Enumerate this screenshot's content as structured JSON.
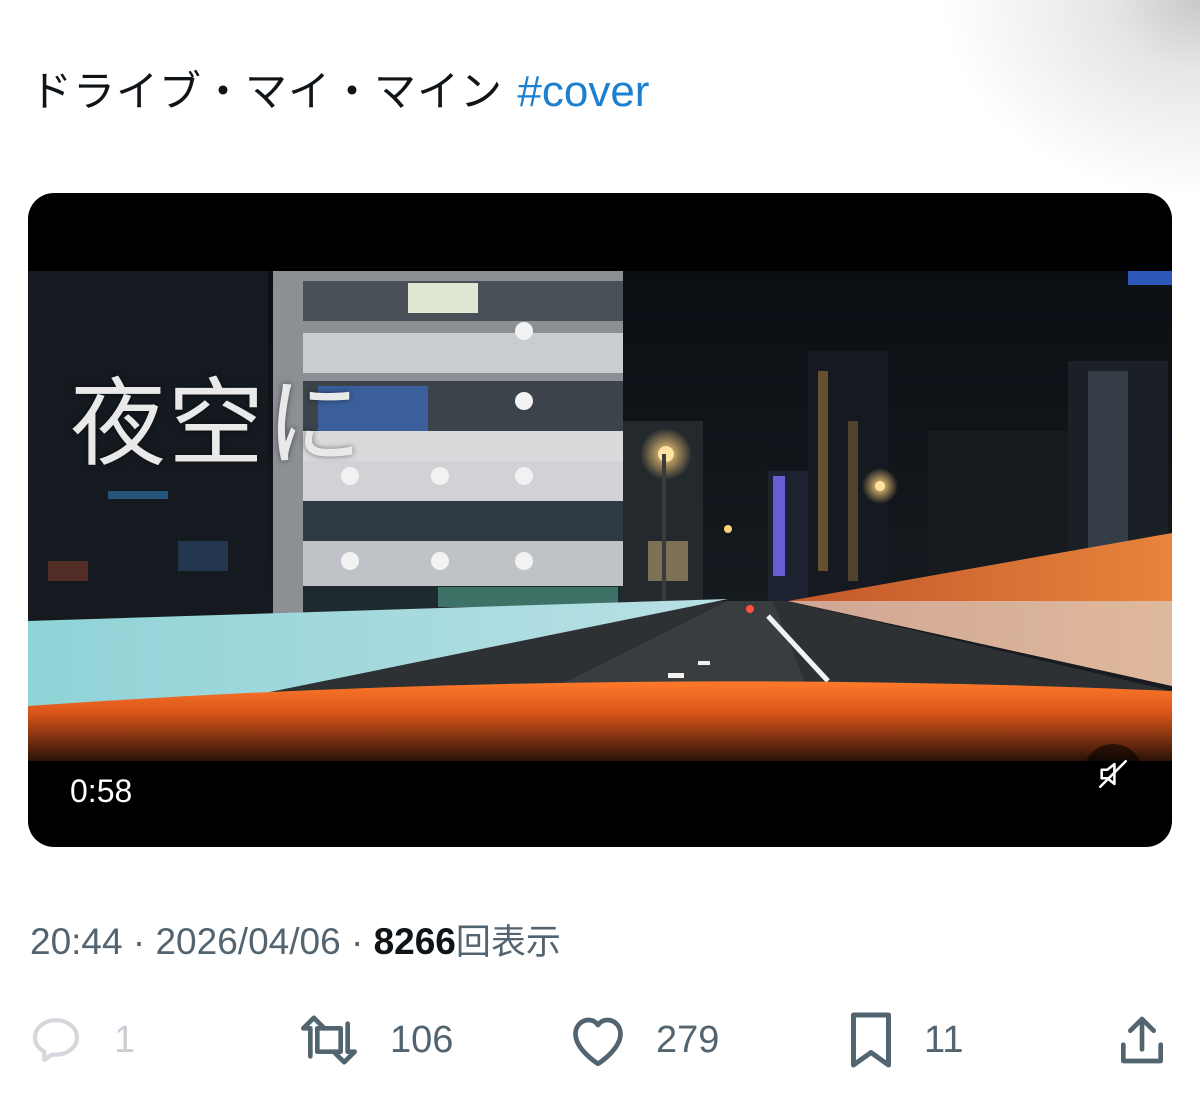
{
  "post": {
    "text": "ドライブ・マイ・マイン",
    "hashtag": "#cover"
  },
  "video": {
    "overlay_text": "夜空に",
    "duration": "0:58",
    "mute_icon": "muted-speaker-icon"
  },
  "meta": {
    "time": "20:44",
    "separator": " · ",
    "date": "2026/04/06",
    "views_count": "8266",
    "views_label": "回表示"
  },
  "actions": {
    "replies": "1",
    "reposts": "106",
    "likes": "279",
    "bookmarks": "11"
  },
  "colors": {
    "hashtag": "#1d7fd0",
    "muted_text": "#536471",
    "video_bg": "#000000"
  }
}
